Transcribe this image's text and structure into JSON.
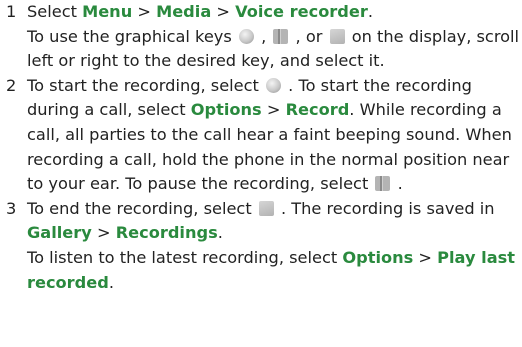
{
  "steps": [
    {
      "number": "1",
      "line1": [
        "Select ",
        "Menu",
        " > ",
        "Media",
        " > ",
        "Voice recorder",
        "."
      ],
      "line2": [
        "To use the graphical keys ",
        "round-button-icon",
        " , ",
        "pause-button-icon",
        " , or ",
        "stop-button-icon",
        " on the display, scroll left or right to the desired key, and select it."
      ]
    },
    {
      "number": "2",
      "text": [
        "To start the recording, select ",
        "round-button-icon",
        " . To start the recording during a call, select ",
        "Options",
        " > ",
        "Record",
        ". While recording a call, all parties to the call hear a faint beeping sound. When recording a call, hold the phone in the normal position near to your ear. To pause the recording, select ",
        "pause-button-icon",
        " ."
      ]
    },
    {
      "number": "3",
      "line1": [
        "To end the recording, select ",
        "stop-button-icon",
        " . The recording is saved in ",
        "Gallery",
        " > ",
        "Recordings",
        "."
      ],
      "line2": [
        "To listen to the latest recording, select ",
        "Options",
        " > ",
        "Play last recorded",
        "."
      ]
    }
  ],
  "colors": {
    "text": "#222222",
    "highlight": "#2a8a3e"
  }
}
